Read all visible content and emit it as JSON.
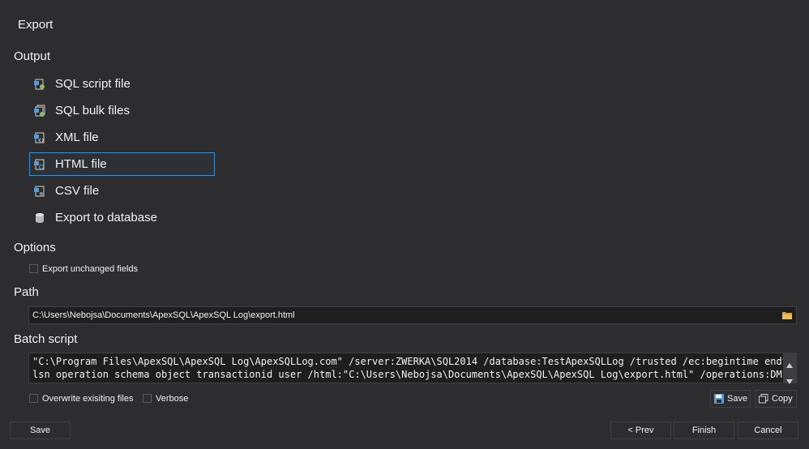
{
  "window": {
    "title": "Export"
  },
  "output": {
    "heading": "Output",
    "items": [
      {
        "label": "SQL script file",
        "icon": "sql-script-file-icon",
        "selected": false
      },
      {
        "label": "SQL bulk files",
        "icon": "sql-bulk-files-icon",
        "selected": false
      },
      {
        "label": "XML file",
        "icon": "xml-file-icon",
        "selected": false
      },
      {
        "label": "HTML file",
        "icon": "html-file-icon",
        "selected": true
      },
      {
        "label": "CSV file",
        "icon": "csv-file-icon",
        "selected": false
      },
      {
        "label": "Export to database",
        "icon": "database-icon",
        "selected": false
      }
    ]
  },
  "options": {
    "heading": "Options",
    "export_unchanged_label": "Export unchanged fields",
    "export_unchanged_checked": false
  },
  "path": {
    "heading": "Path",
    "value": "C:\\Users\\Nebojsa\\Documents\\ApexSQL\\ApexSQL Log\\export.html"
  },
  "batch": {
    "heading": "Batch script",
    "line1": "\"C:\\Program Files\\ApexSQL\\ApexSQL Log\\ApexSQLLog.com\" /server:ZWERKA\\SQL2014 /database:TestApexSQLLog /trusted /ec:begintime endtime",
    "line2": "lsn operation schema object transactionid user /html:\"C:\\Users\\Nebojsa\\Documents\\ApexSQL\\ApexSQL Log\\export.html\" /operations:DMLALL",
    "overwrite_label": "Overwrite exisiting files",
    "verbose_label": "Verbose",
    "save_label": "Save",
    "copy_label": "Copy"
  },
  "footer": {
    "save_label": "Save",
    "prev_label": "< Prev",
    "finish_label": "Finish",
    "cancel_label": "Cancel"
  },
  "colors": {
    "background": "#2d2d30",
    "selection_border": "#3e8ed0",
    "input_background": "#1e1e1e",
    "folder_icon": "#d4a53c"
  }
}
